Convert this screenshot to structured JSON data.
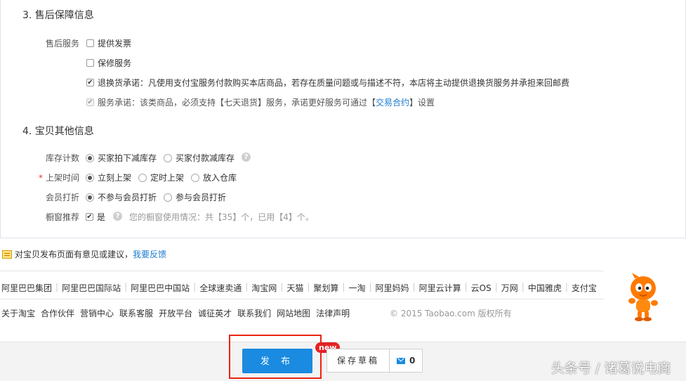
{
  "sections": {
    "after_sales": {
      "title": "3. 售后保障信息",
      "label": "售后服务",
      "options": [
        {
          "text": "提供发票",
          "checked": false
        },
        {
          "text": "保修服务",
          "checked": false
        },
        {
          "text": "退换货承诺：凡使用支付宝服务付款购买本店商品，若存在质量问题或与描述不符，本店将主动提供退换货服务并承担来回邮费",
          "checked": true
        },
        {
          "prefix": "服务承诺：该类商品，必须支持【七天退货】服务，承诺更好服务可通过【",
          "link": "交易合约",
          "suffix": "】设置",
          "checked": true,
          "disabled": true
        }
      ]
    },
    "other": {
      "title": "4. 宝贝其他信息",
      "stock": {
        "label": "库存计数",
        "options": [
          "买家拍下减库存",
          "买家付款减库存"
        ],
        "selected": 0
      },
      "listing": {
        "required_mark": "*",
        "label": "上架时间",
        "options": [
          "立刻上架",
          "定时上架",
          "放入仓库"
        ],
        "selected": 0
      },
      "member": {
        "label": "会员打折",
        "options": [
          "不参与会员打折",
          "参与会员打折"
        ],
        "selected": 0
      },
      "window": {
        "label": "橱窗推荐",
        "checkbox_text": "是",
        "checked": true,
        "usage_text": "您的橱窗使用情况：共【35】个，已用【4】个。"
      }
    }
  },
  "feedback": {
    "text": "对宝贝发布页面有意见或建议，",
    "link": "我要反馈"
  },
  "footer": {
    "links_row1": [
      "阿里巴巴集团",
      "阿里巴巴国际站",
      "阿里巴巴中国站",
      "全球速卖通",
      "淘宝网",
      "天猫",
      "聚划算",
      "一淘",
      "阿里妈妈",
      "阿里云计算",
      "云OS",
      "万网",
      "中国雅虎",
      "支付宝"
    ],
    "links_row2": [
      "关于淘宝",
      "合作伙伴",
      "营销中心",
      "联系客服",
      "开放平台",
      "诚征英才",
      "联系我们",
      "网站地图",
      "法律声明"
    ],
    "copyright": "© 2015 Taobao.com 版权所有"
  },
  "actions": {
    "publish_label": "发 布",
    "new_badge": "new",
    "draft_label": "保存草稿",
    "draft_count": "0"
  },
  "watermark": "头条号 / 诸葛说电商",
  "icons": {
    "help": "question-mark-icon",
    "feedback": "feedback-note-icon",
    "mail": "mail-icon",
    "mascot": "taobao-mascot-icon"
  },
  "colors": {
    "accent": "#1a8be0",
    "link": "#1a7bd0",
    "badge": "#e52222",
    "highlight_box": "#e21"
  }
}
